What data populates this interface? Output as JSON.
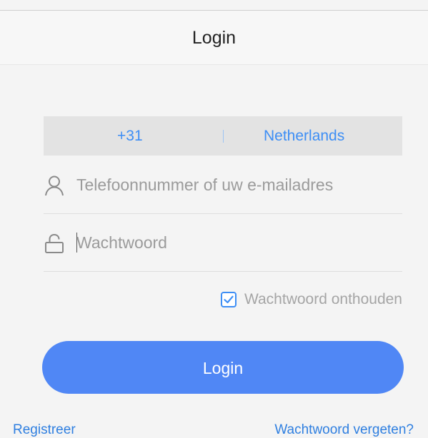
{
  "header": {
    "title": "Login"
  },
  "country": {
    "code": "+31",
    "name": "Netherlands"
  },
  "account": {
    "icon": "user-icon",
    "placeholder": "Telefoonnummer of uw e-mailadres",
    "value": ""
  },
  "password": {
    "icon": "lock-icon",
    "placeholder": "Wachtwoord",
    "value": ""
  },
  "remember": {
    "label": "Wachtwoord onthouden",
    "checked": true
  },
  "login_button": {
    "label": "Login"
  },
  "links": {
    "register": "Registreer",
    "forgot": "Wachtwoord vergeten?"
  },
  "colors": {
    "accent": "#3d8ef5",
    "button": "#5087f5",
    "background": "#f4f4f4",
    "country_bar": "#e3e3e3",
    "placeholder": "#9b9b9b"
  }
}
